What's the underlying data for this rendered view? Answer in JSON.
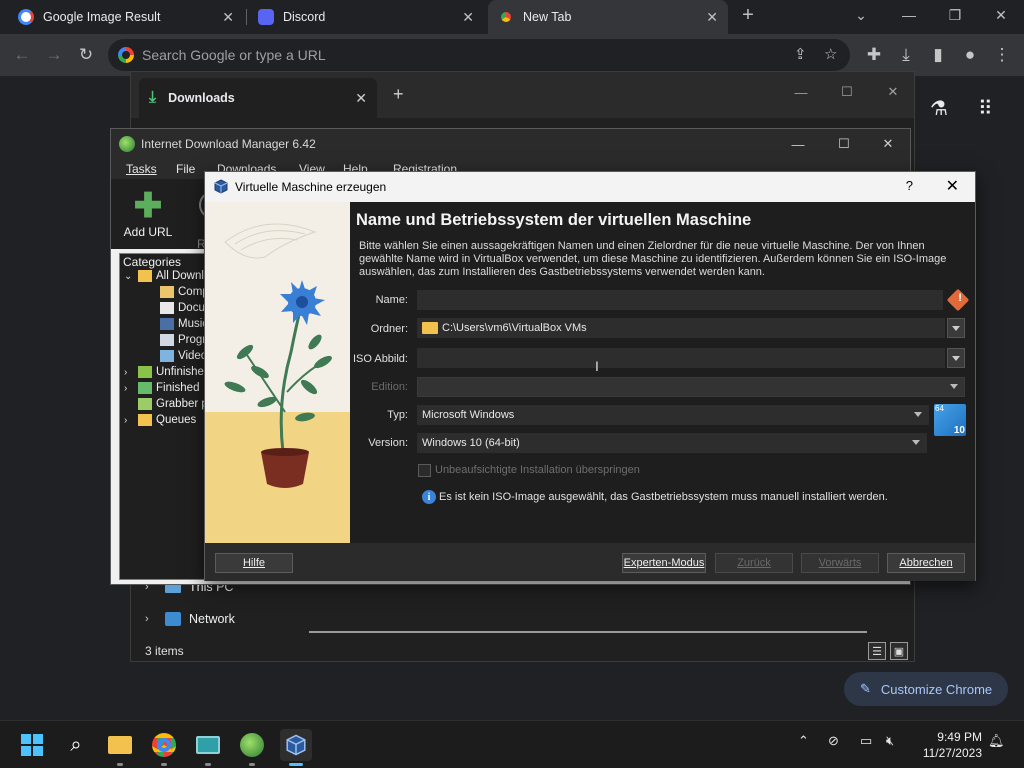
{
  "chrome": {
    "tabs": [
      {
        "title": "Google Image Result",
        "icon": "google-icon"
      },
      {
        "title": "Discord",
        "icon": "discord-icon"
      },
      {
        "title": "New Tab",
        "icon": "chrome-icon"
      }
    ],
    "omnibox_placeholder": "Search Google or type a URL",
    "customize_label": "Customize Chrome"
  },
  "downloads_window": {
    "tab_title": "Downloads",
    "nav": [
      {
        "label": "This PC",
        "icon": "pc-icon"
      },
      {
        "label": "Network",
        "icon": "network-icon"
      }
    ],
    "status": "3 items"
  },
  "idm": {
    "title": "Internet Download Manager 6.42",
    "menu": [
      "Tasks",
      "File",
      "Downloads",
      "View",
      "Help",
      "Registration"
    ],
    "add_url": "Add URL",
    "resume_partial": "R",
    "categories_header": "Categories",
    "tree": [
      {
        "label": "All Downloads",
        "level": 0
      },
      {
        "label": "Compressed",
        "level": 1
      },
      {
        "label": "Documents",
        "level": 1
      },
      {
        "label": "Music",
        "level": 1
      },
      {
        "label": "Programs",
        "level": 1
      },
      {
        "label": "Video",
        "level": 1
      },
      {
        "label": "Unfinished",
        "level": 0
      },
      {
        "label": "Finished",
        "level": 0
      },
      {
        "label": "Grabber projects",
        "level": 0
      },
      {
        "label": "Queues",
        "level": 0
      }
    ]
  },
  "vbox": {
    "title": "Virtuelle Maschine erzeugen",
    "help_glyph": "?",
    "heading": "Name und Betriebssystem der virtuellen Maschine",
    "description": "Bitte wählen Sie einen aussagekräftigen Namen und einen Zielordner für die neue virtuelle Maschine. Der von Ihnen gewählte Name wird in VirtualBox verwendet, um diese Maschine zu identifizieren. Außerdem können Sie ein ISO-Image auswählen, das zum Installieren des Gastbetriebssystems verwendet werden kann.",
    "labels": {
      "name": "Name:",
      "folder": "Ordner:",
      "iso": "ISO Abbild:",
      "edition": "Edition:",
      "type": "Typ:",
      "version": "Version:"
    },
    "values": {
      "name": "",
      "folder": "C:\\Users\\vm6\\VirtualBox VMs",
      "iso": "",
      "edition": "",
      "type": "Microsoft Windows",
      "version": "Windows 10 (64-bit)"
    },
    "os_badge": {
      "bits": "64",
      "version": "10"
    },
    "skip_unattended": "Unbeaufsichtigte Installation überspringen",
    "info": "Es ist kein ISO-Image ausgewählt, das Gastbetriebssystem muss manuell installiert werden.",
    "buttons": {
      "help": "Hilfe",
      "expert": "Experten-Modus",
      "back": "Zurück",
      "next": "Vorwärts",
      "cancel": "Abbrechen"
    }
  },
  "taskbar": {
    "time": "9:49 PM",
    "date": "11/27/2023"
  },
  "colors": {
    "chrome_bg": "#202124",
    "chrome_toolbar": "#35363a",
    "customize_text": "#a8c7fa",
    "vbox_dialog_bg": "#1e1e1e",
    "art_table": "#f1d584",
    "flower_blue": "#3a7fd6"
  }
}
